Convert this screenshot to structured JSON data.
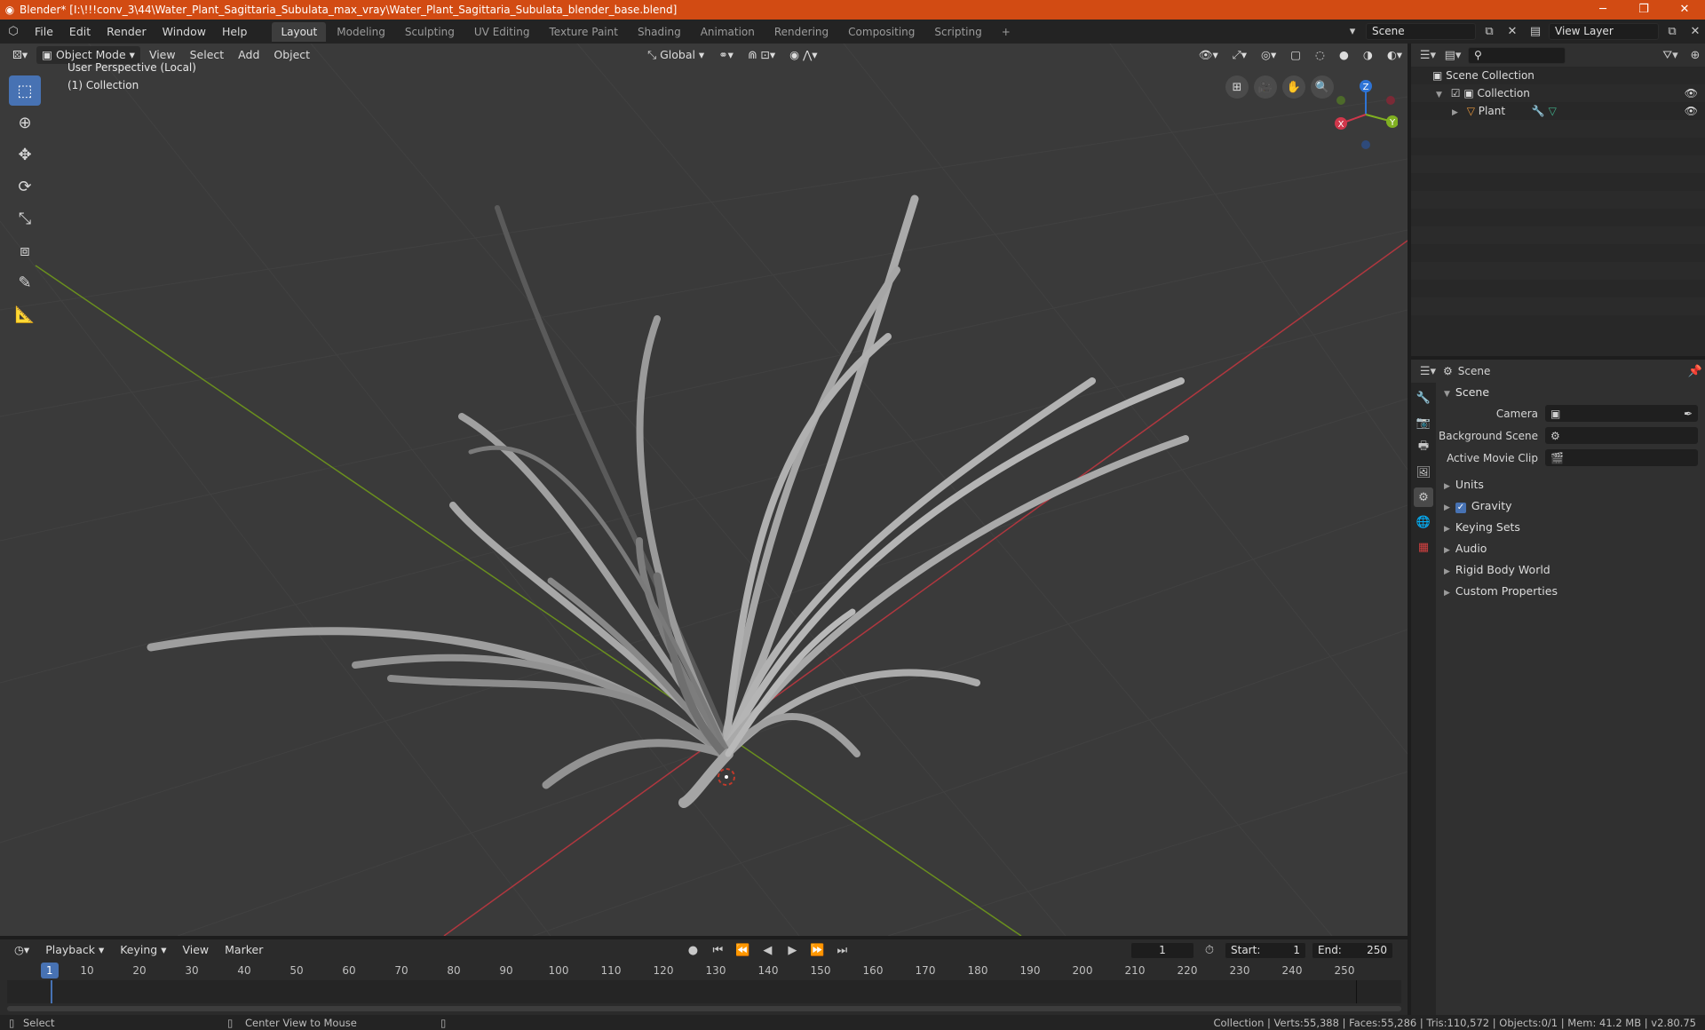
{
  "titlebar": {
    "title": "Blender* [I:\\!!!conv_3\\44\\Water_Plant_Sagittaria_Subulata_max_vray\\Water_Plant_Sagittaria_Subulata_blender_base.blend]",
    "minimize": "─",
    "restore": "❐",
    "close": "✕"
  },
  "menus": [
    "File",
    "Edit",
    "Render",
    "Window",
    "Help"
  ],
  "workspaces": [
    "Layout",
    "Modeling",
    "Sculpting",
    "UV Editing",
    "Texture Paint",
    "Shading",
    "Animation",
    "Rendering",
    "Compositing",
    "Scripting"
  ],
  "add_workspace": "+",
  "scene_field": "Scene",
  "view_layer_field": "View Layer",
  "viewport": {
    "mode": "Object Mode",
    "menus": [
      "View",
      "Select",
      "Add",
      "Object"
    ],
    "orientation": "Global",
    "perspective_label": "User Perspective (Local)",
    "collection_label": "(1) Collection",
    "gizmo": {
      "x": "X",
      "y": "Y",
      "z": "Z"
    }
  },
  "timeline": {
    "menus": [
      "Playback",
      "Keying",
      "View",
      "Marker"
    ],
    "current_frame": "1",
    "start_label": "Start:",
    "start": "1",
    "end_label": "End:",
    "end": "250",
    "ruler": [
      "10",
      "20",
      "30",
      "40",
      "50",
      "60",
      "70",
      "80",
      "90",
      "100",
      "110",
      "120",
      "130",
      "140",
      "150",
      "160",
      "170",
      "180",
      "190",
      "200",
      "210",
      "220",
      "230",
      "240",
      "250"
    ],
    "ruler_current": "1"
  },
  "statusbar": {
    "select": "Select",
    "center_view": "Center View to Mouse",
    "stats": "Collection | Verts:55,388 | Faces:55,286 | Tris:110,572 | Objects:0/1 | Mem: 41.2 MB | v2.80.75"
  },
  "outliner": {
    "scene_collection": "Scene Collection",
    "collection": "Collection",
    "object": "Plant"
  },
  "properties": {
    "header_title": "Scene",
    "panel": "Scene",
    "rows": [
      {
        "label": "Camera",
        "value": ""
      },
      {
        "label": "Background Scene",
        "value": ""
      },
      {
        "label": "Active Movie Clip",
        "value": ""
      }
    ],
    "subpanels": [
      "Units",
      "Gravity",
      "Keying Sets",
      "Audio",
      "Rigid Body World",
      "Custom Properties"
    ]
  },
  "colors": {
    "accent": "#4772b3",
    "title_bar": "#d24b13",
    "axis_x": "#b0373f",
    "axis_y": "#6a8f1e"
  }
}
